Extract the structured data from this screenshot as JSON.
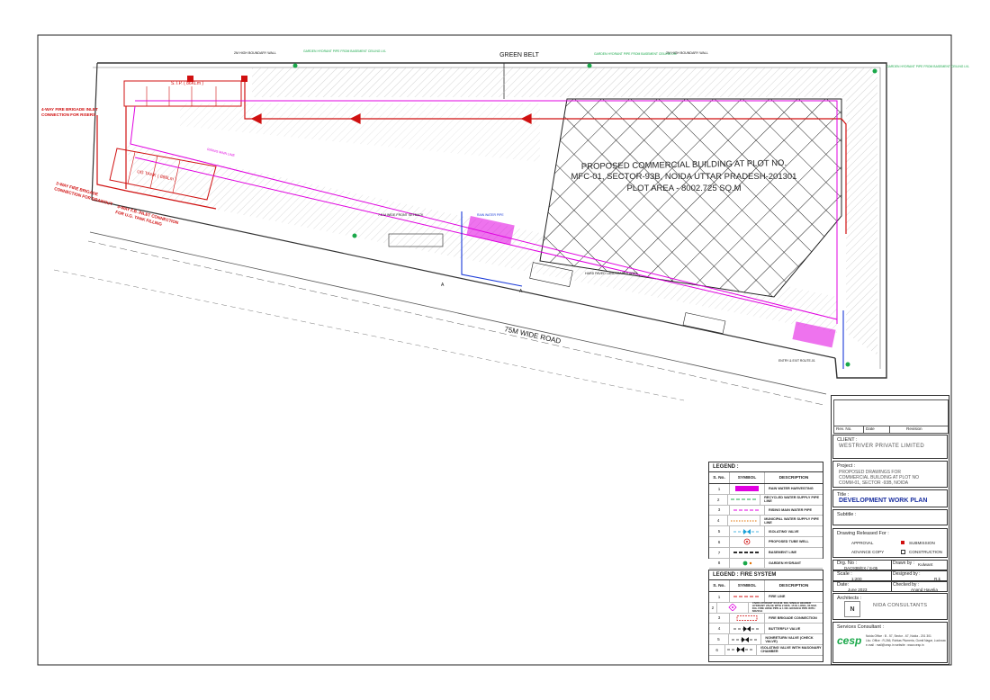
{
  "plan": {
    "green_belt": "GREEN BELT",
    "boundary_wall_left": "2M HIGH BOUNDARY WALL",
    "boundary_wall_mid": "2M HIGH BOUNDARY WALL",
    "hydrant_note_1": "GARDEN HYDRANT PIPE FROM BASEMENT CEILING LVL",
    "hydrant_note_2": "GARDEN HYDRANT PIPE FROM BASEMENT CEILING LVL",
    "hydrant_note_3": "GARDEN HYDRANT PIPE FROM BASEMENT CEILING LVL",
    "building_title_1": "PROPOSED COMMERCIAL BUILDING AT PLOT NO.",
    "building_title_2": "MFC-01, SECTOR-93B, NOIDA UTTAR PRADESH-201301",
    "building_title_3": "PLOT AREA - 8002.725 SQ.M",
    "road": "75M WIDE ROAD",
    "stp": "S.T.P. ( 86KLm )",
    "ug_tank": "UG TANK ( 886Lm )",
    "fire_inlet_1a": "4-WAY FIRE BRIGADE INLET",
    "fire_inlet_1b": "CONNECTION FOR RISERS",
    "fire_inlet_2a": "2-WAY FIRE BRIGADE",
    "fire_inlet_2b": "CONNECTION FOR DRAWOUT",
    "fire_inlet_3a": "4-WAY F.B. INLET CONNECTION",
    "fire_inlet_3b": "FOR U.G. TANK FILLING",
    "front_setback": "7.5 M WIDE FRONT SETBACK",
    "hard_paved": "HARD PAVED LANDSCAPED AREA",
    "rising_main": "RISING MAIN LINE",
    "entry_exit": "ENTRY & EXIT ROUTE-01",
    "rain_pipe": "RAIN WATER PIPE",
    "marker_a": "A"
  },
  "legend": {
    "title": "LEGEND :",
    "col_sno": "S. No.",
    "col_symbol": "SYMBOL",
    "col_desc": "DESCRIPTION",
    "items": [
      {
        "n": "1",
        "desc": "RAIN WATER HARVESTING",
        "color": "#e000e0",
        "style": "block"
      },
      {
        "n": "2",
        "desc": "RECYCLED WATER SUPPLY PIPE LINE",
        "color": "#1aa84a",
        "style": "dash"
      },
      {
        "n": "3",
        "desc": "RISING MAIN WATER PIPE",
        "color": "#e000e0",
        "style": "dash"
      },
      {
        "n": "4",
        "desc": "MUNICIPAL WATER SUPPLY PIPE LINE",
        "color": "#e07000",
        "style": "dot"
      },
      {
        "n": "5",
        "desc": "ISOLATING VALVE",
        "color": "#1aa0d8",
        "style": "valve"
      },
      {
        "n": "6",
        "desc": "PROPOSED TUBE WELL",
        "color": "#d01010",
        "style": "circle"
      },
      {
        "n": "7",
        "desc": "BASEMENT LINE",
        "color": "#111111",
        "style": "dashbold"
      },
      {
        "n": "8",
        "desc": "GARDEN HYDRANT",
        "color": "#1aa84a",
        "style": "hydrant"
      }
    ]
  },
  "fire_legend": {
    "title": "LEGEND : FIRE SYSTEM",
    "col_sno": "S. No.",
    "col_symbol": "SYMBOL",
    "col_desc": "DESCRIPTION",
    "items": [
      {
        "n": "1",
        "desc": "FIRE LINE",
        "color": "#d01010",
        "style": "dash"
      },
      {
        "n": "2",
        "desc": "YARD HYDRANT 63 M.M. DIA. SINGLE HEADED HYDRANT VALVE WITH 2 NOS. 15 M. LONG, 63 M.M. DIA. FIRE HOSE PIPE & 1 NO. BRANCH PIPE WITH NOZZLE",
        "color": "#e000e0",
        "style": "yard"
      },
      {
        "n": "3",
        "desc": "FIRE BRIGADE CONNECTION",
        "color": "#d01010",
        "style": "fbc"
      },
      {
        "n": "4",
        "desc": "BUTTERFLY VALVE",
        "color": "#111111",
        "style": "valve"
      },
      {
        "n": "5",
        "desc": "NONRETURN VALVE (CHECK VALVE)",
        "color": "#111111",
        "style": "valve"
      },
      {
        "n": "6",
        "desc": "ISOLATING VALVE WITH MASONARY CHAMBER",
        "color": "#111111",
        "style": "valve"
      }
    ]
  },
  "titleblock": {
    "rev_no": "Rev. No.",
    "date_col": "Date",
    "revision": "Revision",
    "client_label": "CLIENT :",
    "client_name": "WESTRIVER PRIVATE LIMITED",
    "project_label": "Project :",
    "project_1": "PROPOSED DRAWINGS FOR",
    "project_2": "COMMERCIAL BUILDING AT PLOT NO",
    "project_3": "COMM-01, SECTOR -93B, NOIDA",
    "title_label": "Title :",
    "title": "DEVELOPMENT WORK PLAN",
    "subtitle_label": "Subtitle :",
    "released_label": "Drawing Released For :",
    "approval": "APPROVAL",
    "submission": "SUBMISSION",
    "advance_copy": "ADVANCE COPY",
    "construction": "CONSTRUCTION",
    "drg_no_label": "Drg. No :",
    "drg_no": "DAC93B/EX / S-05",
    "drawn_by_label": "Drawn by :",
    "drawn_by": "Kulwant",
    "scale_label": "Scale :",
    "scale": "1:200",
    "designed_by_label": "Designed by :",
    "designed_by": "R.k",
    "date_label": "Date:",
    "date": "June 2023",
    "checked_by_label": "Checked by :",
    "checked_by": "Anand Havelia",
    "architects_label": "Architects :",
    "architect_name": "NIDA CONSULTANTS",
    "services_label": "Services Consultant :",
    "cesp": "cesp",
    "cesp_address_1": "Noida Office : B - 57, Sector - 67, Noida - 201 301",
    "cesp_address_2": "Lko. Office : R-266, Rohtas Plumeria, Gomti Nagar, Lucknow",
    "cesp_address_3": "e-mail : mail@cesp.in   website : www.cesp.in"
  }
}
